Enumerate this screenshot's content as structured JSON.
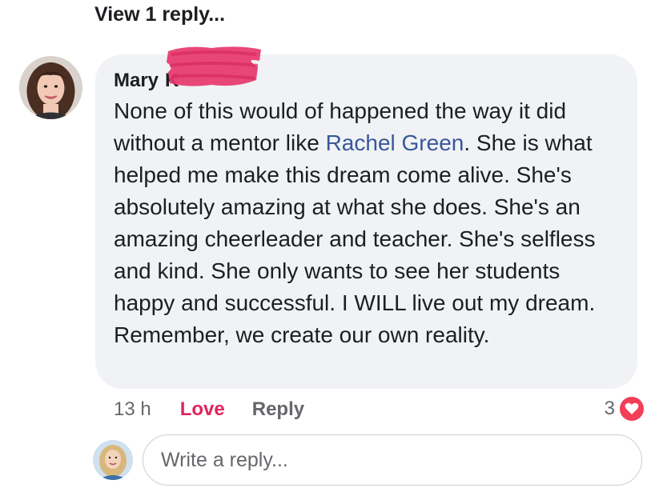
{
  "thread": {
    "view_replies_label": "View 1 reply..."
  },
  "comment": {
    "author_first_name": "Mary",
    "author_last_initial_fragment": "K",
    "text_before_mention": "None of this would of happened the way it did without a mentor like ",
    "mention": "Rachel Green",
    "text_after_mention": ". She is what helped me make this dream come alive. She's absolutely amazing at what she does. She's an amazing cheerleader and teacher. She's selfless and kind. She only wants to see her students happy and successful. I WILL live out my dream. Remember, we create our own reality.",
    "timestamp": "13 h",
    "reaction_label": "Love",
    "reply_label": "Reply",
    "reaction_count": "3",
    "reaction_type": "heart-icon"
  },
  "reply_box": {
    "placeholder": "Write a reply..."
  },
  "colors": {
    "bubble_bg": "#f0f2f5",
    "mention": "#385898",
    "love": "#e0245e",
    "heart_badge": "#f33e58",
    "redaction": "#e8376d"
  }
}
